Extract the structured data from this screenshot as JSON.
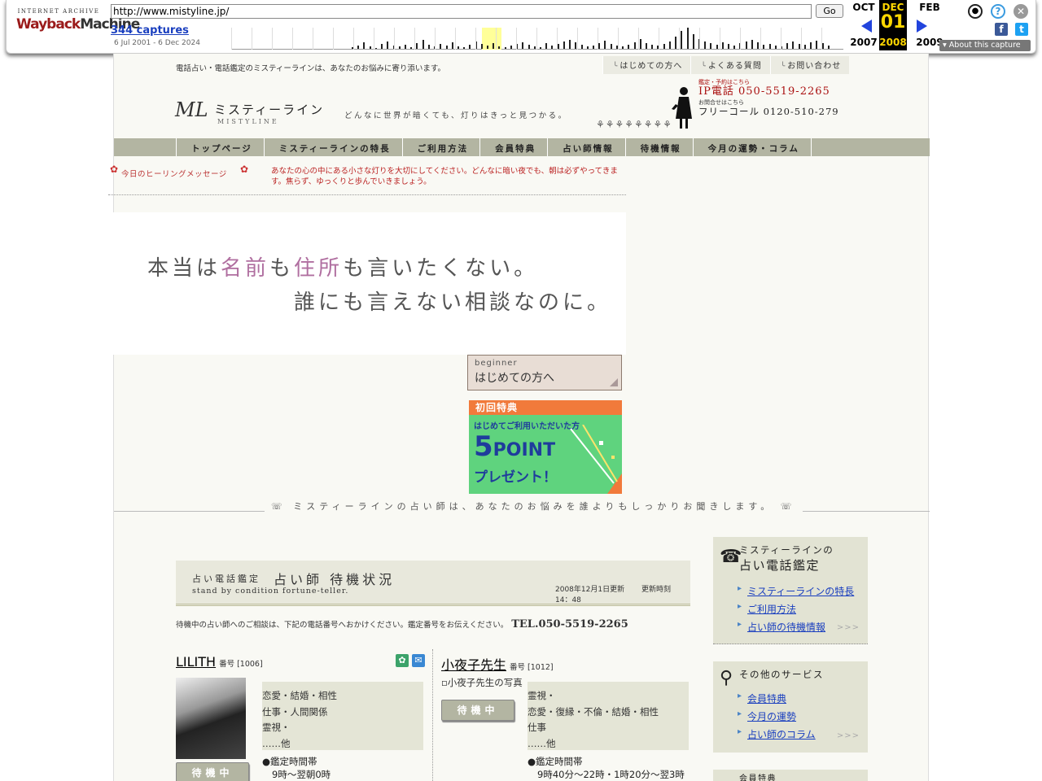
{
  "wayback": {
    "logo_top": "INTERNET ARCHIVE",
    "logo_main_red": "Wayback",
    "logo_main_dark": "Machine",
    "url": "http://www.mistyline.jp/",
    "go_label": "Go",
    "captures": "344 captures",
    "date_range": "6 Jul 2001 - 6 Dec 2024",
    "prev_month": "OCT",
    "cur_month": "DEC",
    "next_month": "FEB",
    "prev_year": "2007",
    "cur_day": "01",
    "cur_year": "2008",
    "next_year": "2009",
    "about": "About this capture",
    "highlight_color": "#ffff99",
    "spark": [
      2,
      4,
      8,
      3,
      1,
      6,
      9,
      4,
      3,
      5,
      2,
      7,
      11,
      5,
      3,
      6,
      4,
      8,
      3,
      2,
      5,
      9,
      6,
      4,
      7,
      3,
      2,
      4,
      6,
      8,
      5,
      3,
      2,
      7,
      4,
      6,
      9,
      11,
      8,
      5,
      3,
      4,
      7,
      10,
      6,
      4,
      3,
      5,
      8,
      12,
      7,
      5,
      4,
      6,
      9,
      15,
      22,
      26,
      18,
      12,
      9,
      7,
      5,
      8,
      6,
      4,
      7,
      9,
      11,
      8,
      5,
      6,
      4,
      3,
      7,
      9,
      6,
      5,
      8,
      10,
      7,
      4
    ]
  },
  "site": {
    "tagline": "電話占い・電話鑑定のミスティーラインは、あなたのお悩みに寄り添います。",
    "top_links": [
      "はじめての方へ",
      "よくある質問",
      "お問い合わせ"
    ],
    "logo_ml": "ML",
    "logo_jp": "ミスティーライン",
    "logo_en": "MISTYLINE",
    "slogan": "どんなに世界が暗くても、灯りはきっと見つかる。",
    "flowers": "⚘⚘⚘⚘⚘⚘⚘⚘",
    "phone_l1": "鑑定・予約はこちら",
    "phone_l2": "IP電話 050-5519-2265",
    "phone_l3": "お問合せはこちら",
    "phone_l4": "フリーコール 0120-510-279",
    "nav": [
      "トップページ",
      "ミスティーラインの特長",
      "ご利用方法",
      "会員特典",
      "占い師情報",
      "待機情報",
      "今月の運勢・コラム"
    ],
    "healing_label": "今日のヒーリングメッセージ",
    "healing_msg": "あなたの心の中にある小さな灯りを大切にしてください。どんなに暗い夜でも、朝は必ずやってきます。焦らず、ゆっくりと歩んでいきましょう。",
    "hero_line1_a": "本当は",
    "hero_line1_b": "名前",
    "hero_line1_c": "も",
    "hero_line1_d": "住所",
    "hero_line1_e": "も言いたくない。",
    "hero_line2": "誰にも言えない相談なのに。",
    "beginner_small": "beginner",
    "beginner_big": "はじめての方へ",
    "bonus_head": "初回特典",
    "bonus_sub": "はじめてご利用いただいた方",
    "bonus_point_num": "5",
    "bonus_point_word": "POINT",
    "bonus_present": "プレゼント！",
    "separator": "ミスティーラインの占い師は、あなたのお悩みを誰よりもしっかりお聞きします。",
    "standby_s1": "占い電話鑑定",
    "standby_s2": "占い師 待機状況",
    "standby_s3": "stand by condition fortune-teller.",
    "standby_dt": "2008年12月1日更新　　 更新時刻　14：48",
    "tel_text": "待機中の占い師へのご相談は、下記の電話番号へおかけください。鑑定番号をお伝えください。",
    "tel_number": "TEL.050-5519-2265",
    "teller1": {
      "name": "LILITH",
      "id": "番号 [1006]",
      "tags": [
        "恋愛・結婚・相性",
        "仕事・人間関係",
        "霊視・",
        "……他"
      ],
      "hours_label": "●鑑定時間帯",
      "hours": "9時〜翌朝0時",
      "status": "待機中"
    },
    "teller2": {
      "name": "小夜子先生",
      "id": "番号 [1012]",
      "photo_alt": "小夜子先生の写真",
      "tags": [
        "霊視・",
        "恋愛・復縁・不倫・結婚・相性",
        "仕事",
        "……他"
      ],
      "hours_label": "●鑑定時間帯",
      "hours": "9時40分〜22時・1時20分〜翌3時",
      "status": "待機中"
    },
    "side1": {
      "t1": "ミスティーラインの",
      "t2": "占い電話鑑定",
      "links": [
        "ミスティーラインの特長",
        "ご利用方法",
        "占い師の待機情報"
      ],
      "more": ">>>"
    },
    "side2": {
      "t1": "その他のサービス",
      "links": [
        "会員特典",
        "今月の運勢",
        "占い師のコラム"
      ],
      "more": ">>>"
    },
    "side3": {
      "t1": "会員特典"
    }
  }
}
